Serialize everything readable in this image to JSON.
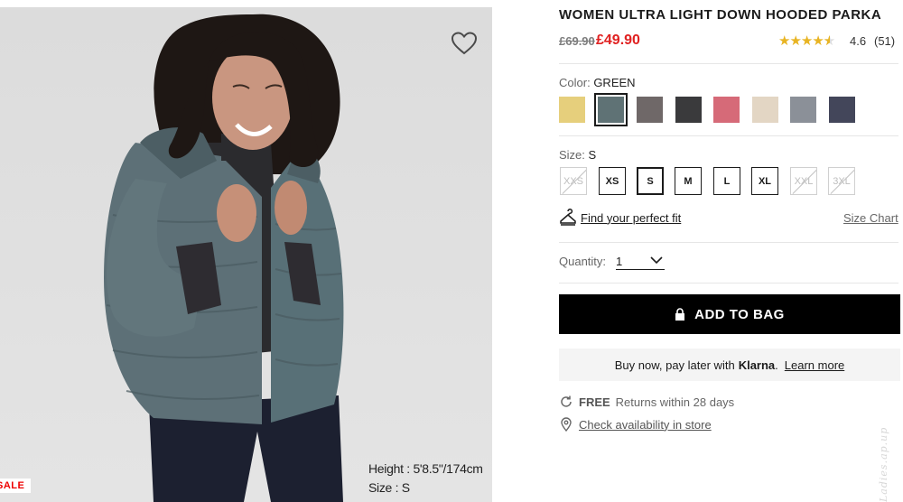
{
  "product": {
    "title": "WOMEN ULTRA LIGHT DOWN HOODED PARKA",
    "old_price": "£69.90",
    "sale_price": "£49.90",
    "rating_stars": 4.6,
    "rating_value": "4.6",
    "rating_count": "(51)"
  },
  "image": {
    "model_height": "Height : 5'8.5\"/174cm",
    "model_size": "Size : S",
    "badge": "SALE"
  },
  "color": {
    "label": "Color:",
    "selected": "GREEN",
    "swatches": [
      {
        "name": "yellow",
        "hex": "#e6cf7c"
      },
      {
        "name": "green",
        "hex": "#5f7275"
      },
      {
        "name": "brown",
        "hex": "#6f6868"
      },
      {
        "name": "dark-gray",
        "hex": "#3a3a3c"
      },
      {
        "name": "pink",
        "hex": "#d66a78"
      },
      {
        "name": "beige",
        "hex": "#e3d6c4"
      },
      {
        "name": "gray",
        "hex": "#8b9098"
      },
      {
        "name": "navy",
        "hex": "#43465a"
      }
    ]
  },
  "size": {
    "label": "Size:",
    "selected": "S",
    "options": [
      {
        "label": "XXS",
        "state": "unavailable"
      },
      {
        "label": "XS",
        "state": "available"
      },
      {
        "label": "S",
        "state": "selected"
      },
      {
        "label": "M",
        "state": "available"
      },
      {
        "label": "L",
        "state": "available"
      },
      {
        "label": "XL",
        "state": "available"
      },
      {
        "label": "XXL",
        "state": "unavailable"
      },
      {
        "label": "3XL",
        "state": "unavailable"
      }
    ],
    "fit_link": "Find your perfect fit",
    "chart_link": "Size Chart"
  },
  "quantity": {
    "label": "Quantity:",
    "value": "1"
  },
  "actions": {
    "add_to_bag": "ADD TO BAG"
  },
  "klarna": {
    "text": "Buy now, pay later with",
    "brand": "Klarna",
    "dot": ".",
    "learn_more": "Learn more"
  },
  "delivery": {
    "free": "FREE",
    "returns_text": "Returns within 28 days",
    "store_link": "Check availability in store"
  },
  "colors": {
    "sale_red": "#e02121",
    "star_gold": "#e8b423",
    "button_black": "#000000"
  },
  "watermark": "Ladies.ap.up"
}
